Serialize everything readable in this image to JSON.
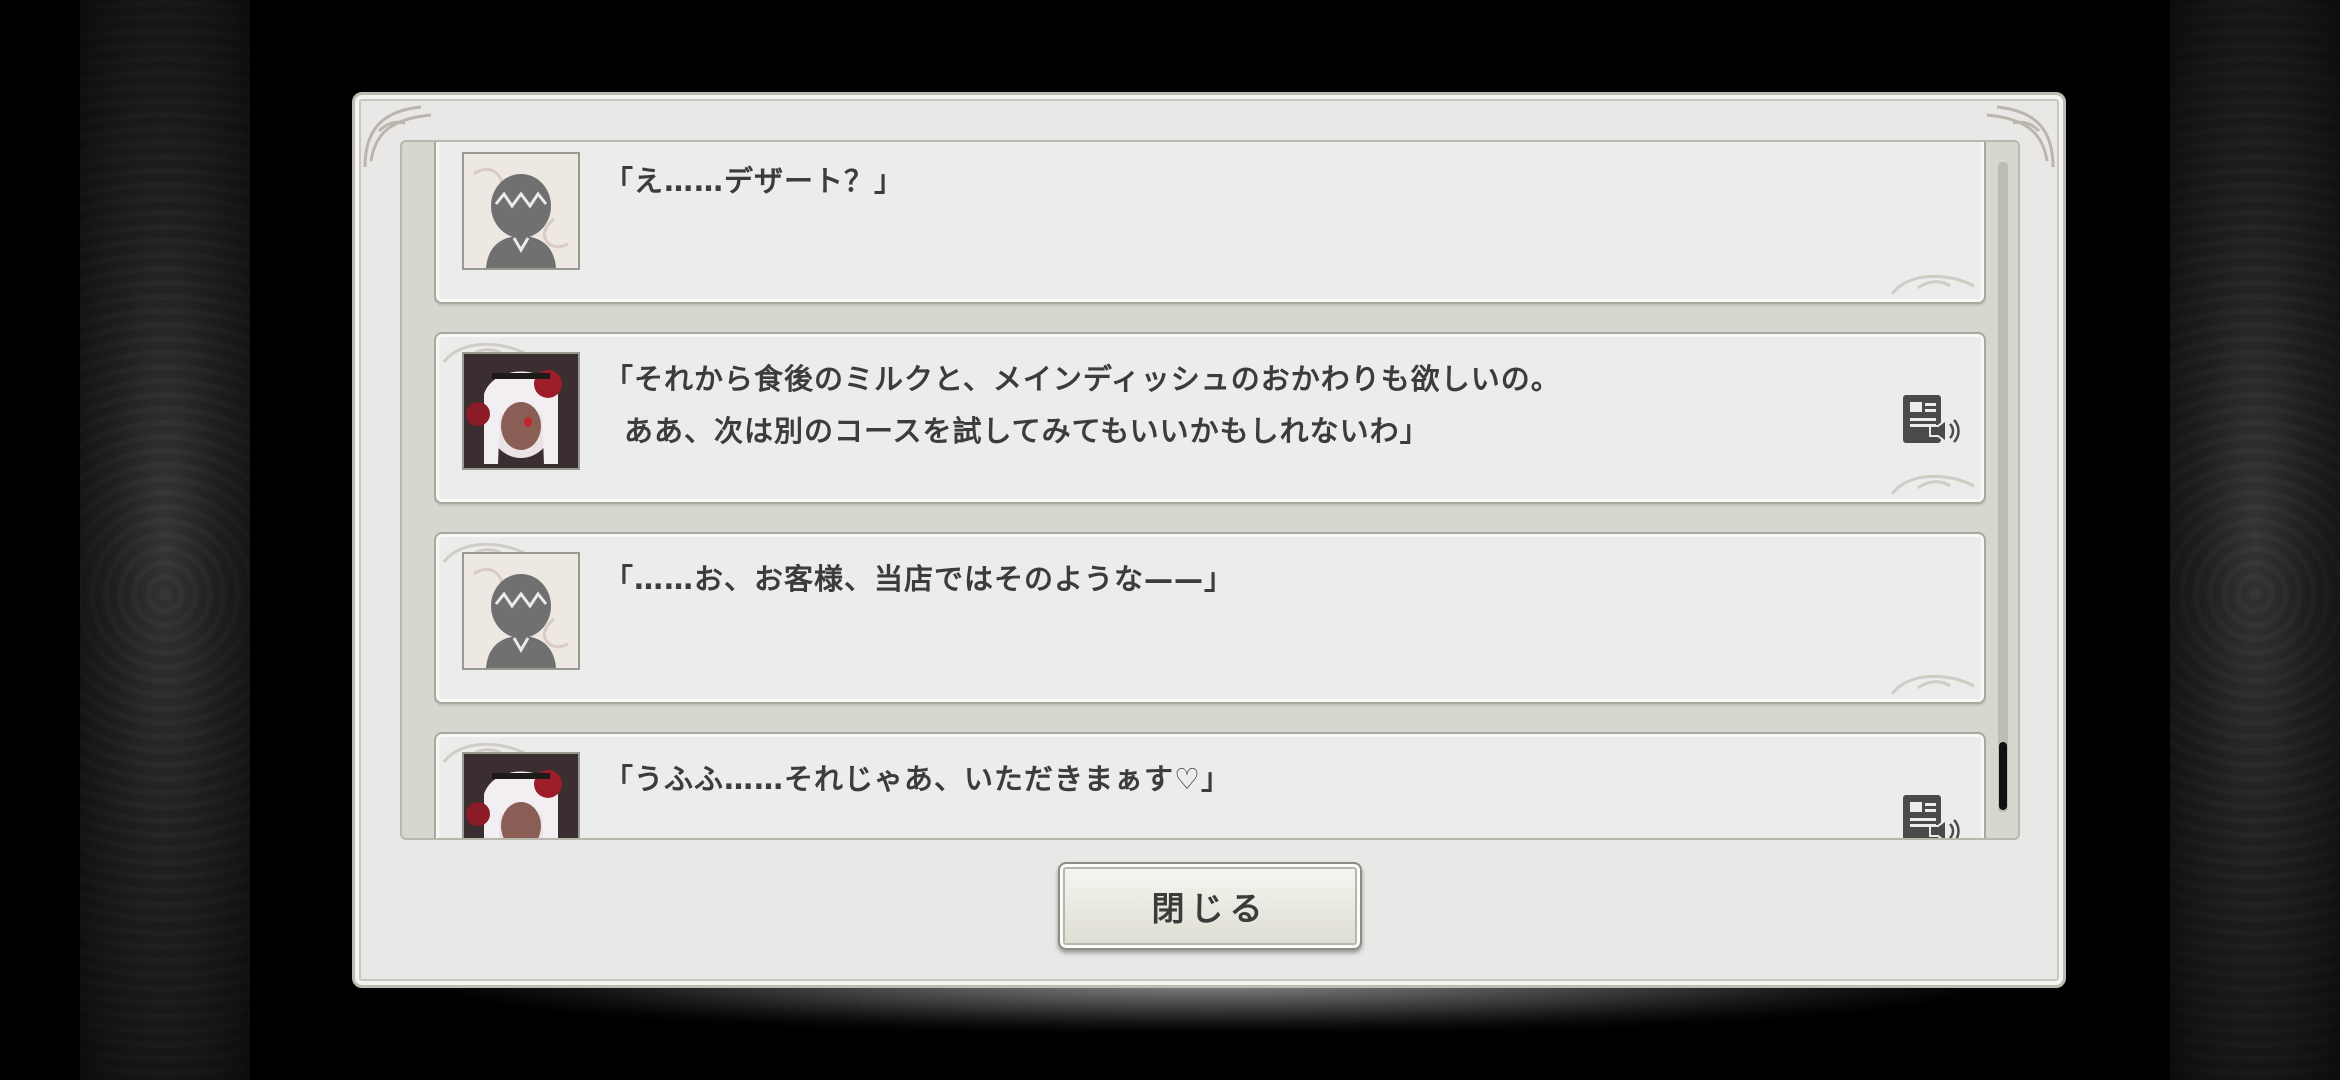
{
  "colors": {
    "dialog_bg": "#e9e8e6",
    "entry_bg": "#ececec",
    "text": "#3c3c3c",
    "scroll_thumb": "#111111"
  },
  "log": {
    "entries": [
      {
        "speaker": "protagonist",
        "portrait": "silhouette-portrait",
        "lines": [
          "「え……デザート？」"
        ],
        "has_voice": false
      },
      {
        "speaker": "maid",
        "portrait": "maid-portrait",
        "lines": [
          "「それから食後のミルクと、メインディッシュのおかわりも欲しいの。",
          "ああ、次は別のコースを試してみてもいいかもしれないわ」"
        ],
        "has_voice": true
      },
      {
        "speaker": "protagonist",
        "portrait": "silhouette-portrait",
        "lines": [
          "「……お、お客様、当店ではそのような——」"
        ],
        "has_voice": false
      },
      {
        "speaker": "maid",
        "portrait": "maid-portrait",
        "lines": [
          "「うふふ……それじゃあ、いただきまぁす♡」"
        ],
        "has_voice": true
      }
    ],
    "voice_icon": "voice-replay-icon"
  },
  "close_button": {
    "label": "閉じる"
  }
}
